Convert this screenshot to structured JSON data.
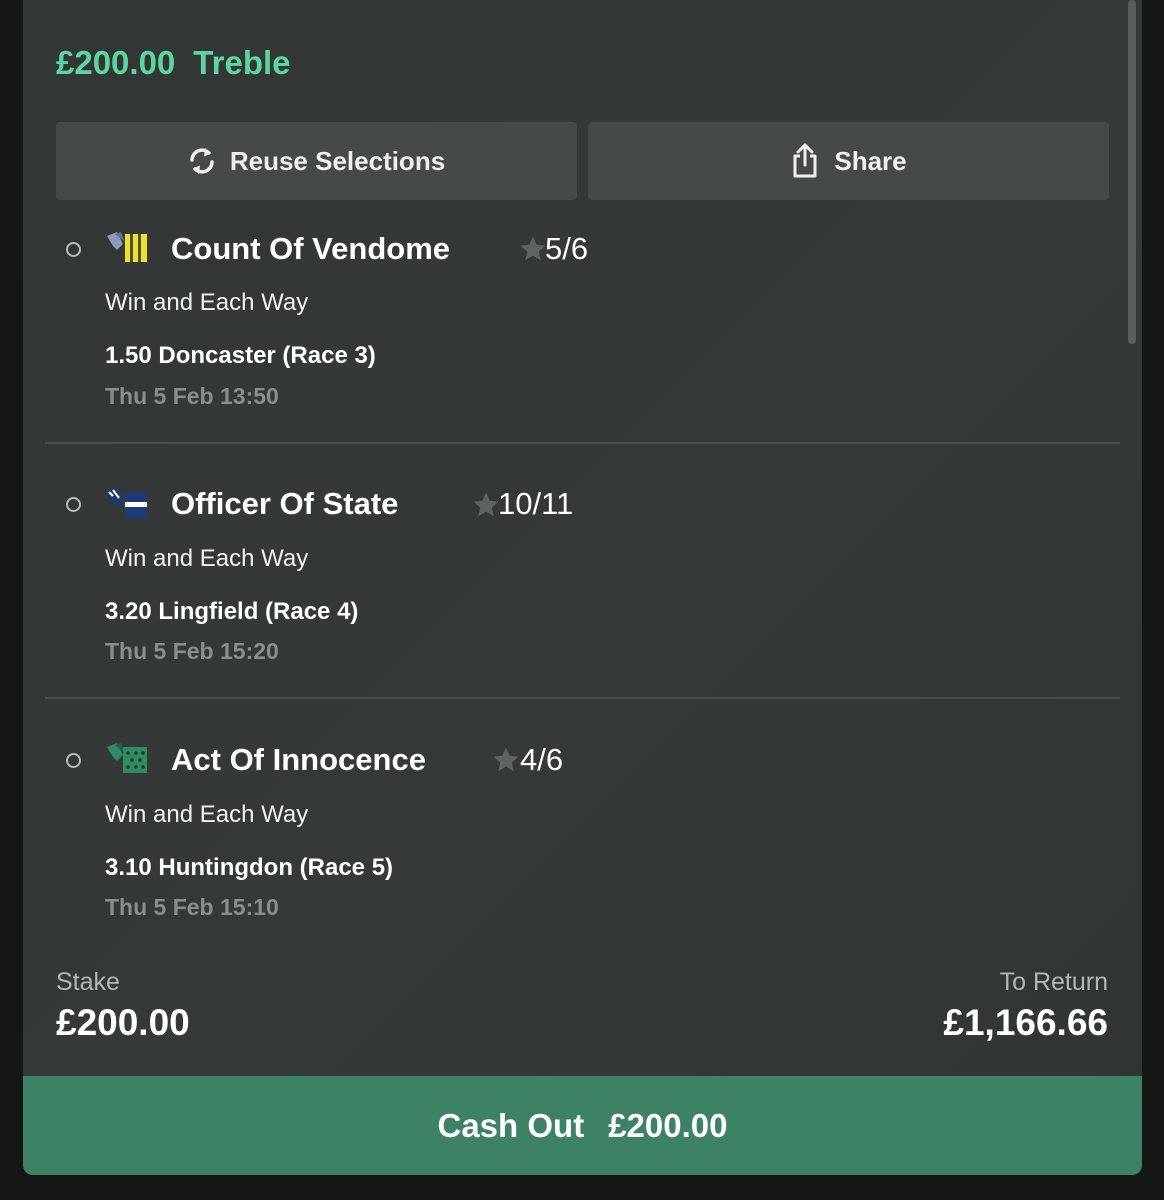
{
  "bet": {
    "amount": "£200.00",
    "type": "Treble"
  },
  "actions": {
    "reuse_label": "Reuse Selections",
    "share_label": "Share"
  },
  "selections": [
    {
      "runner": "Count Of Vendome",
      "odds": "5/6",
      "market": "Win and Each Way",
      "race": "1.50 Doncaster (Race 3)",
      "time": "Thu 5 Feb 13:50",
      "silk_icon": "silk-yellow-stripes-icon"
    },
    {
      "runner": "Officer Of State",
      "odds": "10/11",
      "market": "Win and Each Way",
      "race": "3.20 Lingfield (Race 4)",
      "time": "Thu 5 Feb 15:20",
      "silk_icon": "silk-navy-white-stripe-icon"
    },
    {
      "runner": "Act Of Innocence",
      "odds": "4/6",
      "market": "Win and Each Way",
      "race": "3.10 Huntingdon (Race 5)",
      "time": "Thu 5 Feb 15:10",
      "silk_icon": "silk-green-spots-icon"
    }
  ],
  "summary": {
    "stake_label": "Stake",
    "stake_value": "£200.00",
    "return_label": "To Return",
    "return_value": "£1,166.66"
  },
  "cash_out": {
    "label": "Cash Out",
    "amount": "£200.00"
  },
  "colors": {
    "accent_green": "#5cd6a0",
    "cash_out_green": "#3d8265",
    "card_bg": "#333735"
  }
}
